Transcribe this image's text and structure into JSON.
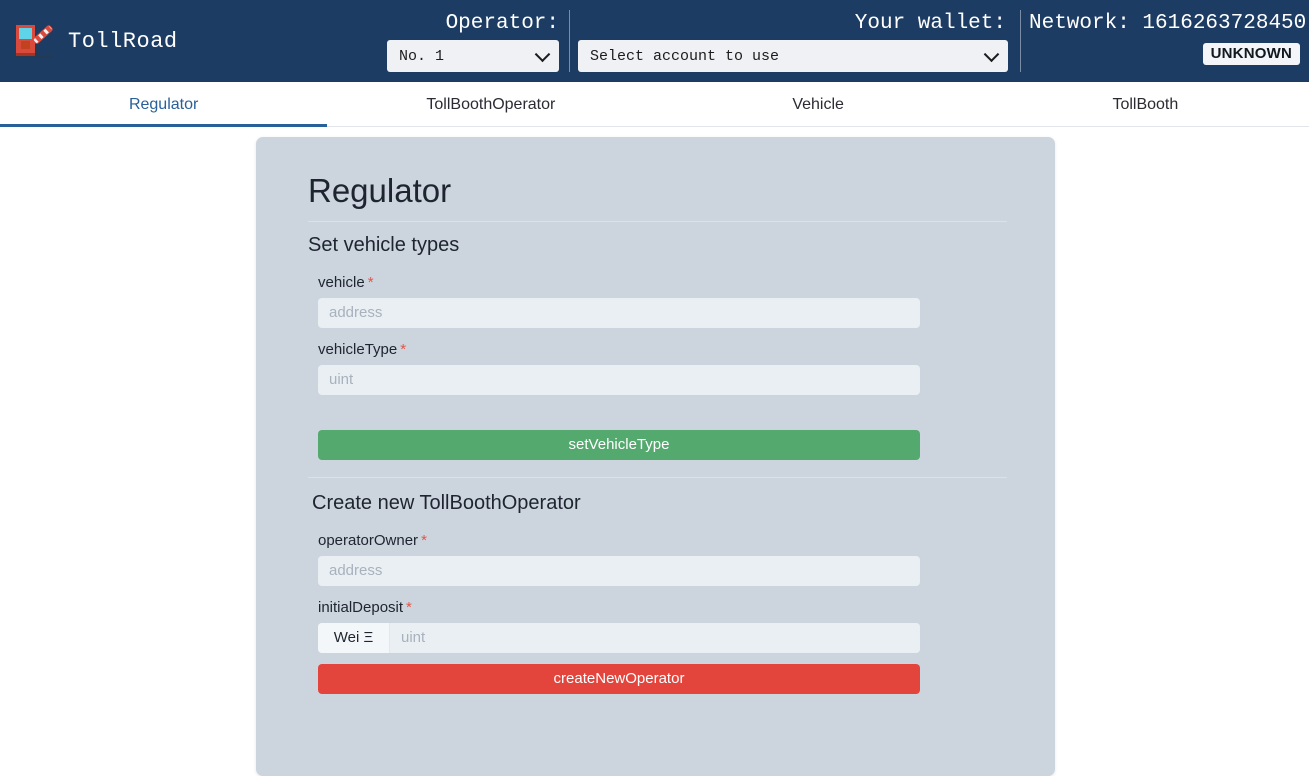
{
  "header": {
    "brand_name": "TollRoad",
    "brand_logo_icon": "tollbooth-barrier-icon",
    "operator_label": "Operator:",
    "operator_select_value": "No. 1",
    "wallet_label": "Your wallet:",
    "wallet_select_value": "Select account to use",
    "network_label": "Network: 1616263728450",
    "network_badge": "UNKNOWN",
    "chevron_icon": "chevron-down-icon"
  },
  "tabs": [
    {
      "label": "Regulator",
      "active": true
    },
    {
      "label": "TollBoothOperator",
      "active": false
    },
    {
      "label": "Vehicle",
      "active": false
    },
    {
      "label": "TollBooth",
      "active": false
    }
  ],
  "panel": {
    "title": "Regulator",
    "sections": [
      {
        "heading": "Set vehicle types",
        "fields": [
          {
            "label": "vehicle",
            "required_marker": "*",
            "placeholder": "address",
            "value": ""
          },
          {
            "label": "vehicleType",
            "required_marker": "*",
            "placeholder": "uint",
            "value": ""
          }
        ],
        "submit_label": "setVehicleType"
      },
      {
        "heading": "Create new TollBoothOperator",
        "fields": [
          {
            "label": "operatorOwner",
            "required_marker": "*",
            "placeholder": "address",
            "value": ""
          },
          {
            "label": "initialDeposit",
            "required_marker": "*",
            "placeholder": "uint",
            "value": "",
            "prefix": "Wei Ξ"
          }
        ],
        "submit_label": "createNewOperator"
      }
    ]
  },
  "colors": {
    "header_bg": "#1d3c63",
    "panel_bg": "#ccd4dd",
    "accent_blue": "#2a6099",
    "success_green": "#54a96f",
    "danger_red": "#e3453c",
    "required_star": "#e2564a",
    "input_bg": "#eaeff3"
  }
}
